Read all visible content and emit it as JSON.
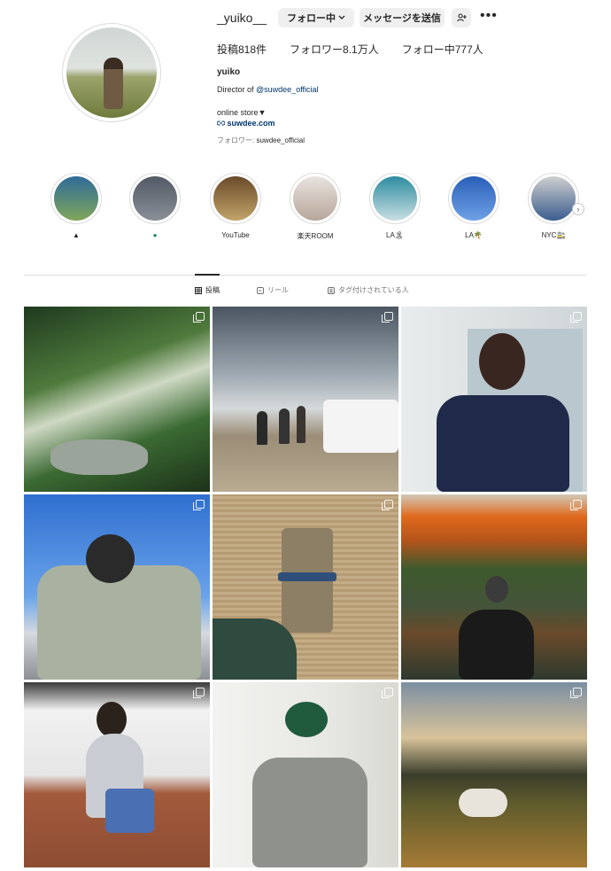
{
  "profile": {
    "username": "_yuiko__",
    "follow_button": "フォロー中",
    "message_button": "メッセージを送信",
    "stats": {
      "posts": "投稿818件",
      "followers": "フォロワー8.1万人",
      "following": "フォロー中777人"
    },
    "full_name": "yuiko",
    "bio_prefix": "Director of",
    "bio_mention": "@suwdee_official",
    "store_label": "online store▼",
    "link": "suwdee.com",
    "followed_by_prefix": "フォロワー:",
    "followed_by_account": "suwdee_official"
  },
  "highlights": [
    {
      "label": "▲",
      "colors": [
        "#2f6b99",
        "#7fa65a"
      ]
    },
    {
      "label": "●",
      "colors": [
        "#525a66",
        "#8a8f97"
      ]
    },
    {
      "label": "YouTube",
      "colors": [
        "#6a4a2a",
        "#c2a46a"
      ]
    },
    {
      "label": "楽天ROOM",
      "colors": [
        "#e8e3df",
        "#b7a69a"
      ]
    },
    {
      "label": "LA🏝",
      "colors": [
        "#2d8ca0",
        "#c9dfe2"
      ]
    },
    {
      "label": "LA🌴",
      "colors": [
        "#2a5fb8",
        "#6fa1e6"
      ]
    },
    {
      "label": "NYC🚉",
      "colors": [
        "#cfcfcf",
        "#3a5d8e"
      ]
    }
  ],
  "tabs": [
    {
      "label": "投稿",
      "icon": "grid-icon"
    },
    {
      "label": "リール",
      "icon": "reels-icon"
    },
    {
      "label": "タグ付けされている人",
      "icon": "tagged-icon"
    }
  ],
  "posts": [
    {
      "desc": "plants",
      "bg": "linear-gradient(160deg,#1e3a1f 0%,#4f7a3c 35%,#cfd9c4 50%,#3b6a33 70%,#1c3219 100%)"
    },
    {
      "desc": "beach",
      "bg": "linear-gradient(180deg,#4a5561 0%,#9aa5ae 35%,#d5d9da 55%,#9b8d77 70%,#b8ab91 100%)"
    },
    {
      "desc": "selfie-navy",
      "bg": "linear-gradient(90deg,#e9eced 0%,#dfe3e4 40%,#cfd6d8 100%)"
    },
    {
      "desc": "ski-jacket",
      "bg": "linear-gradient(180deg,#2f6fd0 0%,#6aa3ea 55%,#d5dadf 75%,#8c8f93 100%)"
    },
    {
      "desc": "gift",
      "bg": "repeating-linear-gradient(0deg,#c4ac86 0 3px,#b69c74 3px 6px)"
    },
    {
      "desc": "mountain",
      "bg": "linear-gradient(180deg,#d2c9b8 0%,#e0691c 12%,#b4541b 25%,#3e5a2c 40%,#44543a 60%,#6a4a2b 75%,#2d3a2e 100%)"
    },
    {
      "desc": "stairs",
      "bg": "linear-gradient(180deg,#3a3a3a 0%,#f1f1f1 15%,#e6e6e6 50%,#a35a3c 60%,#8d4d33 100%)"
    },
    {
      "desc": "green-cap",
      "bg": "linear-gradient(90deg,#f2f2f0 0%,#e8e8e4 60%,#d9d9d2 100%)"
    },
    {
      "desc": "horse",
      "bg": "linear-gradient(180deg,#7c8fa3 0%,#d8c39a 30%,#3a3e2b 50%,#5e5a2c 65%,#a57b35 100%)"
    }
  ]
}
